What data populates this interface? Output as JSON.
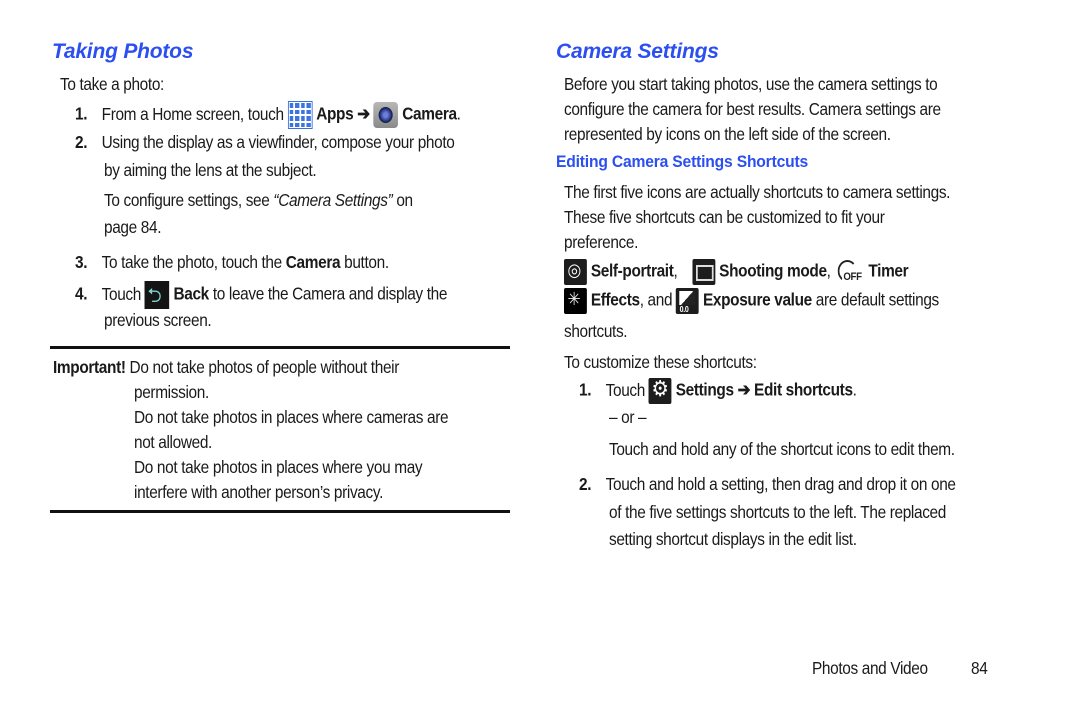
{
  "left": {
    "heading": "Taking Photos",
    "intro": "To take a photo:",
    "steps": [
      {
        "num": "1.",
        "pre": "From a Home screen, touch",
        "apps": "Apps",
        "arrow": "➔",
        "camera": "Camera",
        "end": "."
      },
      {
        "num": "2.",
        "line1": "Using the display as a viewfinder, compose your photo",
        "line2": "by aiming the lens at the subject.",
        "note_pre": "To configure settings, see",
        "note_ref": "“Camera Settings”",
        "note_post": "on",
        "note_line2": "page 84."
      },
      {
        "num": "3.",
        "pre": "To take the photo, touch the",
        "bold": "Camera",
        "post": "button."
      },
      {
        "num": "4.",
        "pre": "Touch",
        "bold": "Back",
        "post": "to leave the Camera and display the",
        "line2": "previous screen."
      }
    ],
    "important": {
      "label": "Important!",
      "lines": [
        "Do not take photos of people without their",
        "permission.",
        "Do not take photos in places where cameras are",
        "not allowed.",
        "Do not take photos in places where you may",
        "interfere with another person’s privacy."
      ]
    }
  },
  "right": {
    "heading": "Camera Settings",
    "intro_lines": [
      "Before you start taking photos, use the camera settings to",
      "configure the camera for best results. Camera settings are",
      "represented by icons on the left side of the screen."
    ],
    "subheading": "Editing Camera Settings Shortcuts",
    "para_lines": [
      "The first five icons are actually shortcuts to camera settings.",
      "These five shortcuts can be customized to fit your",
      "preference."
    ],
    "shortcuts": {
      "self_portrait": "Self-portrait",
      "shooting_mode": "Shooting mode",
      "timer": "Timer",
      "effects": "Effects",
      "and": ", and",
      "exposure": "Exposure value",
      "post": "are default settings",
      "line3": "shortcuts.",
      "comma": ","
    },
    "customize_intro": "To customize these shortcuts:",
    "steps": [
      {
        "num": "1.",
        "pre": "Touch",
        "bold": "Settings ➔ Edit shortcuts",
        "end": ".",
        "or": "– or –",
        "alt": "Touch and hold any of the shortcut icons to edit them."
      },
      {
        "num": "2.",
        "lines": [
          "Touch and hold a setting, then drag and drop it on one",
          "of the five settings shortcuts to the left. The replaced",
          "setting shortcut displays in the edit list."
        ]
      }
    ]
  },
  "footer": {
    "section": "Photos and Video",
    "page": "84"
  },
  "colors": {
    "heading": "#2b4ff0",
    "text": "#1a1a1a"
  }
}
